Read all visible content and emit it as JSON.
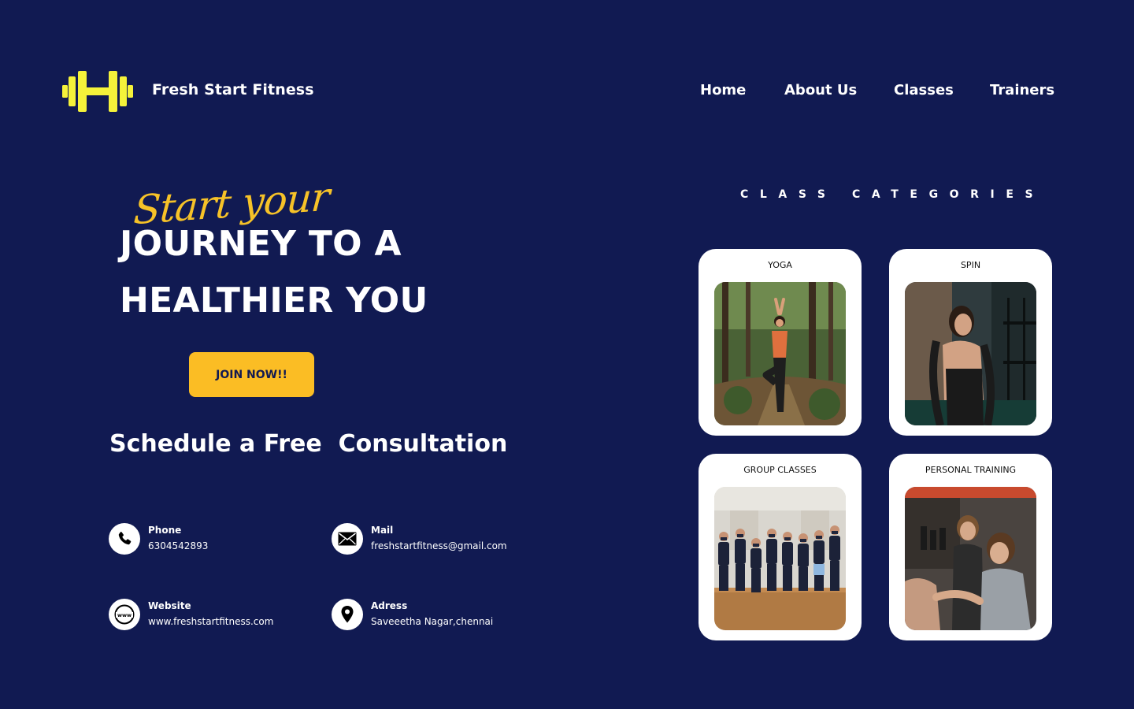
{
  "brand": {
    "name": "Fresh Start Fitness",
    "logo_icon": "dumbbell-h-icon",
    "accent_color": "#f5f23a"
  },
  "nav": {
    "items": [
      {
        "label": "Home"
      },
      {
        "label": "About Us"
      },
      {
        "label": "Classes"
      },
      {
        "label": "Trainers"
      }
    ]
  },
  "hero": {
    "script_text": "Start your",
    "line1": "JOURNEY TO A",
    "line2": "HEALTHIER YOU",
    "cta_label": "JOIN NOW!!",
    "cta_color": "#fbbd24"
  },
  "consultation": {
    "heading": "Schedule a Free  Consultation"
  },
  "contacts": {
    "phone": {
      "label": "Phone",
      "value": "6304542893",
      "icon": "phone-icon"
    },
    "mail": {
      "label": "Mail",
      "value": "freshstartfitness@gmail.com",
      "icon": "envelope-icon"
    },
    "website": {
      "label": "Website",
      "value": "www.freshstartfitness.com",
      "icon": "www-globe-icon"
    },
    "address": {
      "label": "Adress",
      "value": "Saveeetha Nagar,chennai",
      "icon": "location-pin-icon"
    }
  },
  "categories": {
    "title": "CLASS CATEGORIES",
    "items": [
      {
        "label": "YOGA"
      },
      {
        "label": "SPIN"
      },
      {
        "label": "GROUP CLASSES"
      },
      {
        "label": "PERSONAL TRAINING"
      }
    ]
  },
  "colors": {
    "background": "#111a52",
    "card": "#ffffff"
  }
}
